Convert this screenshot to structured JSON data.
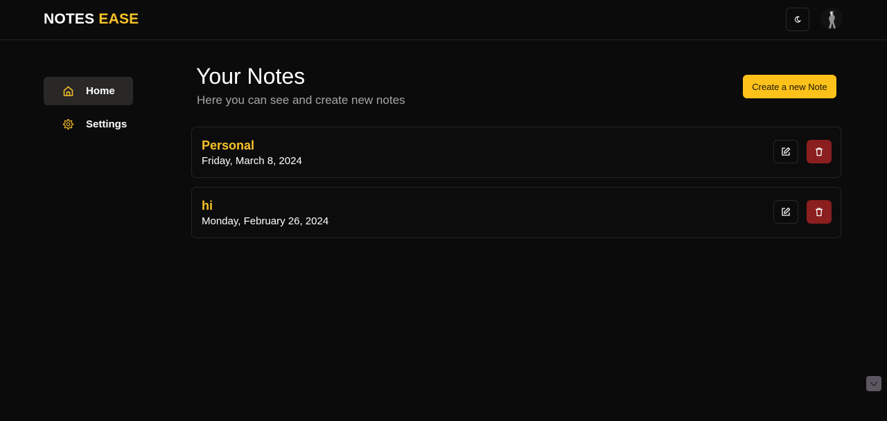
{
  "app": {
    "logo_part1": "NOTES",
    "logo_part2": "EASE",
    "accent_color": "#f6c229",
    "theme_toggle_icon": "moon-icon",
    "avatar_icon": "user-avatar"
  },
  "sidebar": {
    "items": [
      {
        "label": "Home",
        "icon": "home-icon",
        "active": true
      },
      {
        "label": "Settings",
        "icon": "gear-icon",
        "active": false
      }
    ]
  },
  "main": {
    "title": "Your Notes",
    "subtitle": "Here you can see and create new notes",
    "create_button": "Create a new Note"
  },
  "notes": [
    {
      "title": "Personal",
      "date": "Friday, March 8, 2024"
    },
    {
      "title": "hi",
      "date": "Monday, February 26, 2024"
    }
  ],
  "colors": {
    "background": "#0c0b0b",
    "primary_button": "#fcc21a",
    "delete_button": "#8b1e1e"
  }
}
